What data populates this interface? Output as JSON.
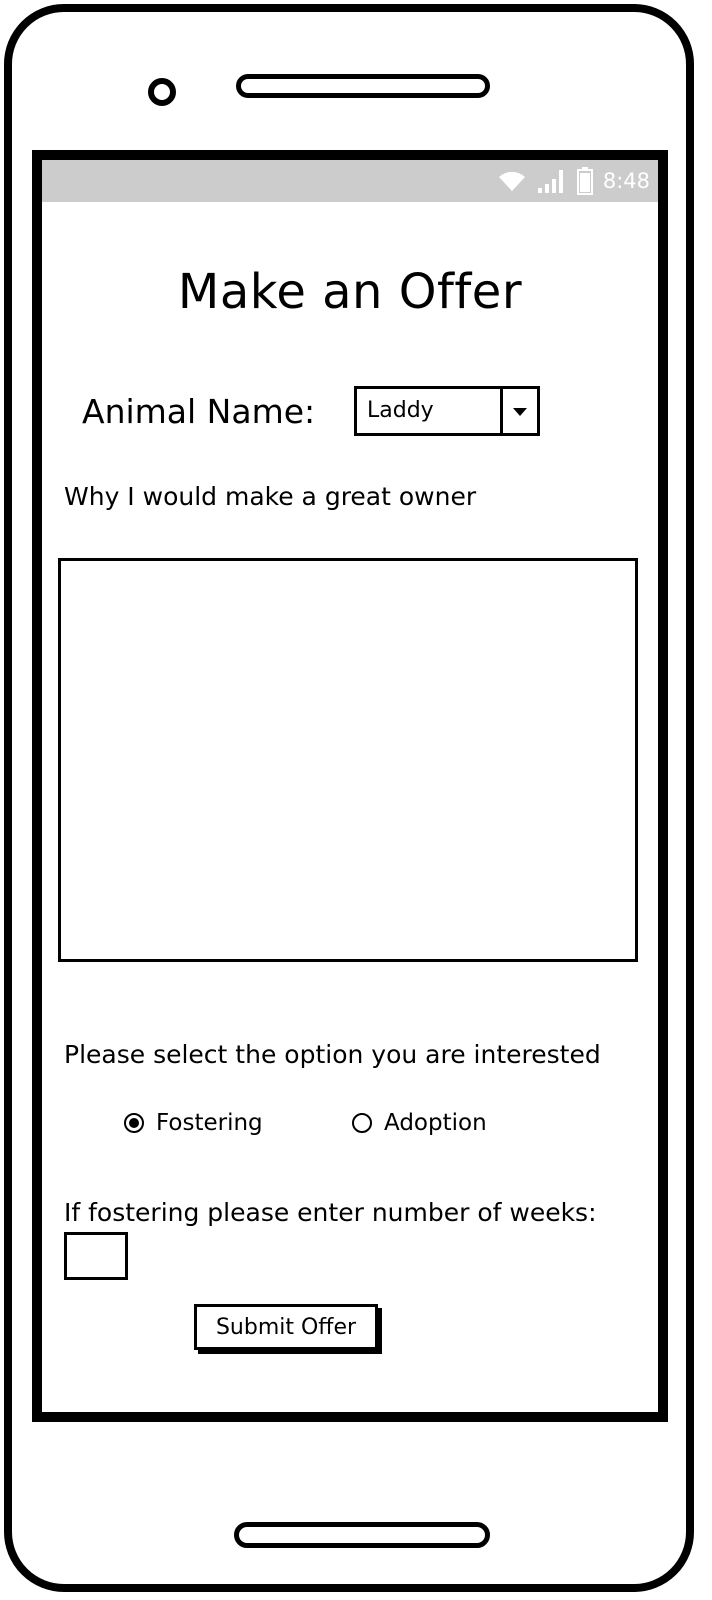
{
  "status_bar": {
    "time": "8:48",
    "icons": [
      "wifi-icon",
      "signal-icon",
      "battery-icon"
    ]
  },
  "page": {
    "title": "Make an Offer"
  },
  "animal": {
    "label": "Animal Name:",
    "selected": "Laddy"
  },
  "why": {
    "label": "Why I would make a great owner",
    "value": ""
  },
  "option": {
    "prompt": "Please select the option you are interested",
    "choices": [
      {
        "label": "Fostering",
        "selected": true
      },
      {
        "label": "Adoption",
        "selected": false
      }
    ]
  },
  "weeks": {
    "label": "If fostering please enter  number of weeks:",
    "value": ""
  },
  "submit": {
    "label": "Submit Offer"
  }
}
